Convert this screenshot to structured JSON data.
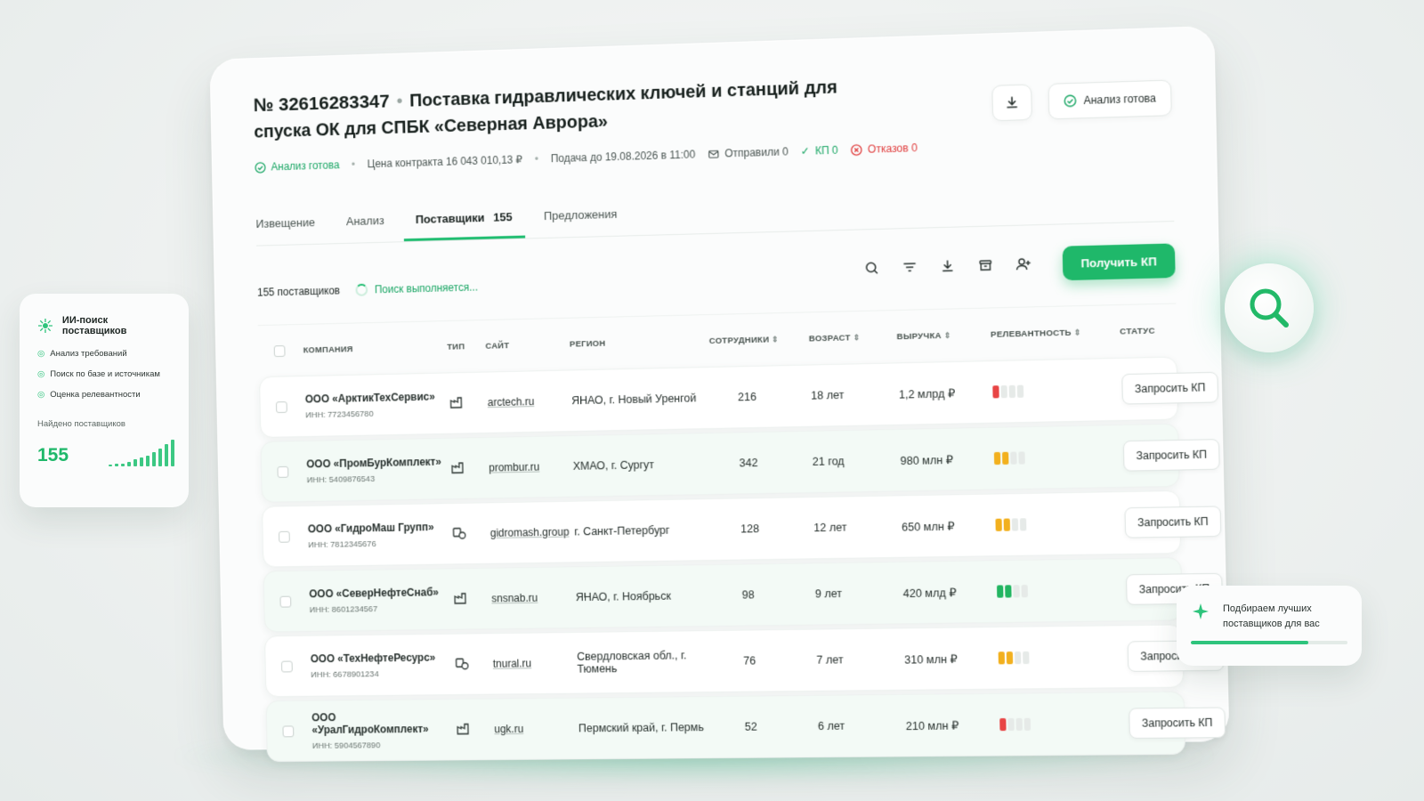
{
  "header": {
    "number": "№ 32616283347",
    "title": "Поставка гидравлических ключей и станций для спуска ОК для СПБК «Северная Аврора»",
    "ready_button": "Анализ готова"
  },
  "meta": {
    "status": "Анализ готова",
    "price": "Цена контракта 16 043 010,13 ₽",
    "deadline": "Подача до 19.08.2026 в 11:00",
    "sent": "Отправили 0",
    "kp": "КП 0",
    "refusals": "Отказов 0"
  },
  "tabs": [
    {
      "label": "Извещение"
    },
    {
      "label": "Анализ"
    },
    {
      "label": "Поставщики",
      "count": "155"
    },
    {
      "label": "Предложения"
    }
  ],
  "toolbar": {
    "count": "155 поставщиков",
    "searching": "Поиск выполняется...",
    "primary": "Получить КП"
  },
  "columns": [
    "КОМПАНИЯ",
    "ТИП",
    "САЙТ",
    "РЕГИОН",
    "СОТРУДНИКИ",
    "ВОЗРАСТ",
    "ВЫРУЧКА",
    "РЕЛЕВАНТНОСТЬ",
    "СТАТУС"
  ],
  "rows": [
    {
      "name": "ООО «АрктикТехСервис»",
      "inn": "ИНН: 7723456780",
      "site": "arctech.ru",
      "region": "ЯНАО, г. Новый Уренгой",
      "employees": "216",
      "age": "18 лет",
      "revenue": "1,2 млрд ₽",
      "relevance": 1,
      "color": "#e84545",
      "action": "Запросить КП"
    },
    {
      "name": "ООО «ПромБурКомплект»",
      "inn": "ИНН: 5409876543",
      "site": "prombur.ru",
      "region": "ХМАО, г. Сургут",
      "employees": "342",
      "age": "21 год",
      "revenue": "980 млн ₽",
      "relevance": 2,
      "color": "#f2b01e",
      "action": "Запросить КП"
    },
    {
      "name": "ООО «ГидроМаш Групп»",
      "inn": "ИНН: 7812345676",
      "site": "gidromash.group",
      "region": "г. Санкт-Петербург",
      "employees": "128",
      "age": "12 лет",
      "revenue": "650 млн ₽",
      "relevance": 2,
      "color": "#f2b01e",
      "action": "Запросить КП"
    },
    {
      "name": "ООО «СеверНефтеСнаб»",
      "inn": "ИНН: 8601234567",
      "site": "snsnab.ru",
      "region": "ЯНАО, г. Ноябрьск",
      "employees": "98",
      "age": "9 лет",
      "revenue": "420 млд ₽",
      "relevance": 2,
      "color": "#22b561",
      "action": "Запросить КП"
    },
    {
      "name": "ООО «ТехНефтеРесурс»",
      "inn": "ИНН: 6678901234",
      "site": "tnural.ru",
      "region": "Свердловская обл., г. Тюмень",
      "employees": "76",
      "age": "7 лет",
      "revenue": "310 млн ₽",
      "relevance": 2,
      "color": "#f2b01e",
      "action": "Запросить КП"
    },
    {
      "name": "ООО «УралГидроКомплект»",
      "inn": "ИНН: 5904567890",
      "site": "ugk.ru",
      "region": "Пермский край, г. Пермь",
      "employees": "52",
      "age": "6 лет",
      "revenue": "210 млн ₽",
      "relevance": 1,
      "color": "#e84545",
      "action": "Запросить КП"
    }
  ],
  "side": {
    "title": "ИИ-поиск поставщиков",
    "steps": [
      "Анализ требований",
      "Поиск по базе и источникам",
      "Оценка релевантности"
    ],
    "found_label": "Найдено поставщиков",
    "found_value": "155"
  },
  "pick": {
    "line1": "Подбираем лучших",
    "line2": "поставщиков для вас",
    "progress": 0.75
  }
}
